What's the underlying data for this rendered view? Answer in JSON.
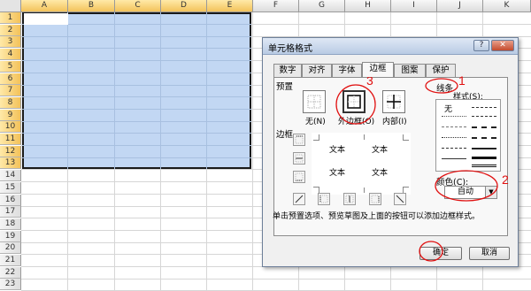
{
  "spreadsheet": {
    "columns": [
      "A",
      "B",
      "C",
      "D",
      "E",
      "F",
      "G",
      "H",
      "I",
      "J",
      "K"
    ],
    "rows": [
      "1",
      "2",
      "3",
      "4",
      "5",
      "6",
      "7",
      "8",
      "9",
      "10",
      "11",
      "12",
      "13",
      "14",
      "15",
      "16",
      "17",
      "18",
      "19",
      "20",
      "21",
      "22",
      "23"
    ]
  },
  "dialog": {
    "title": "单元格格式",
    "help_label": "?",
    "close_label": "✕",
    "tabs": [
      "数字",
      "对齐",
      "字体",
      "边框",
      "图案",
      "保护"
    ],
    "active_tab": "边框",
    "presets": {
      "label": "预置",
      "none": "无(N)",
      "outline": "外边框(O)",
      "inside": "内部(I)"
    },
    "border": {
      "label": "边框",
      "preview_text": "文本"
    },
    "line": {
      "label": "线条",
      "style_label": "样式(S):",
      "none_label": "无"
    },
    "color": {
      "label": "颜色(C):",
      "value": "自动"
    },
    "hint": "单击预置选项、预览草图及上面的按钮可以添加边框样式。",
    "ok_label": "确定",
    "cancel_label": "取消"
  },
  "annotations": {
    "line_mark": "1",
    "color_mark": "2",
    "outline_mark": "3",
    "ink_color": "#e01010"
  },
  "colors": {
    "selection_fill": "#c2d7f3",
    "header_highlight": "#f3c25a"
  }
}
